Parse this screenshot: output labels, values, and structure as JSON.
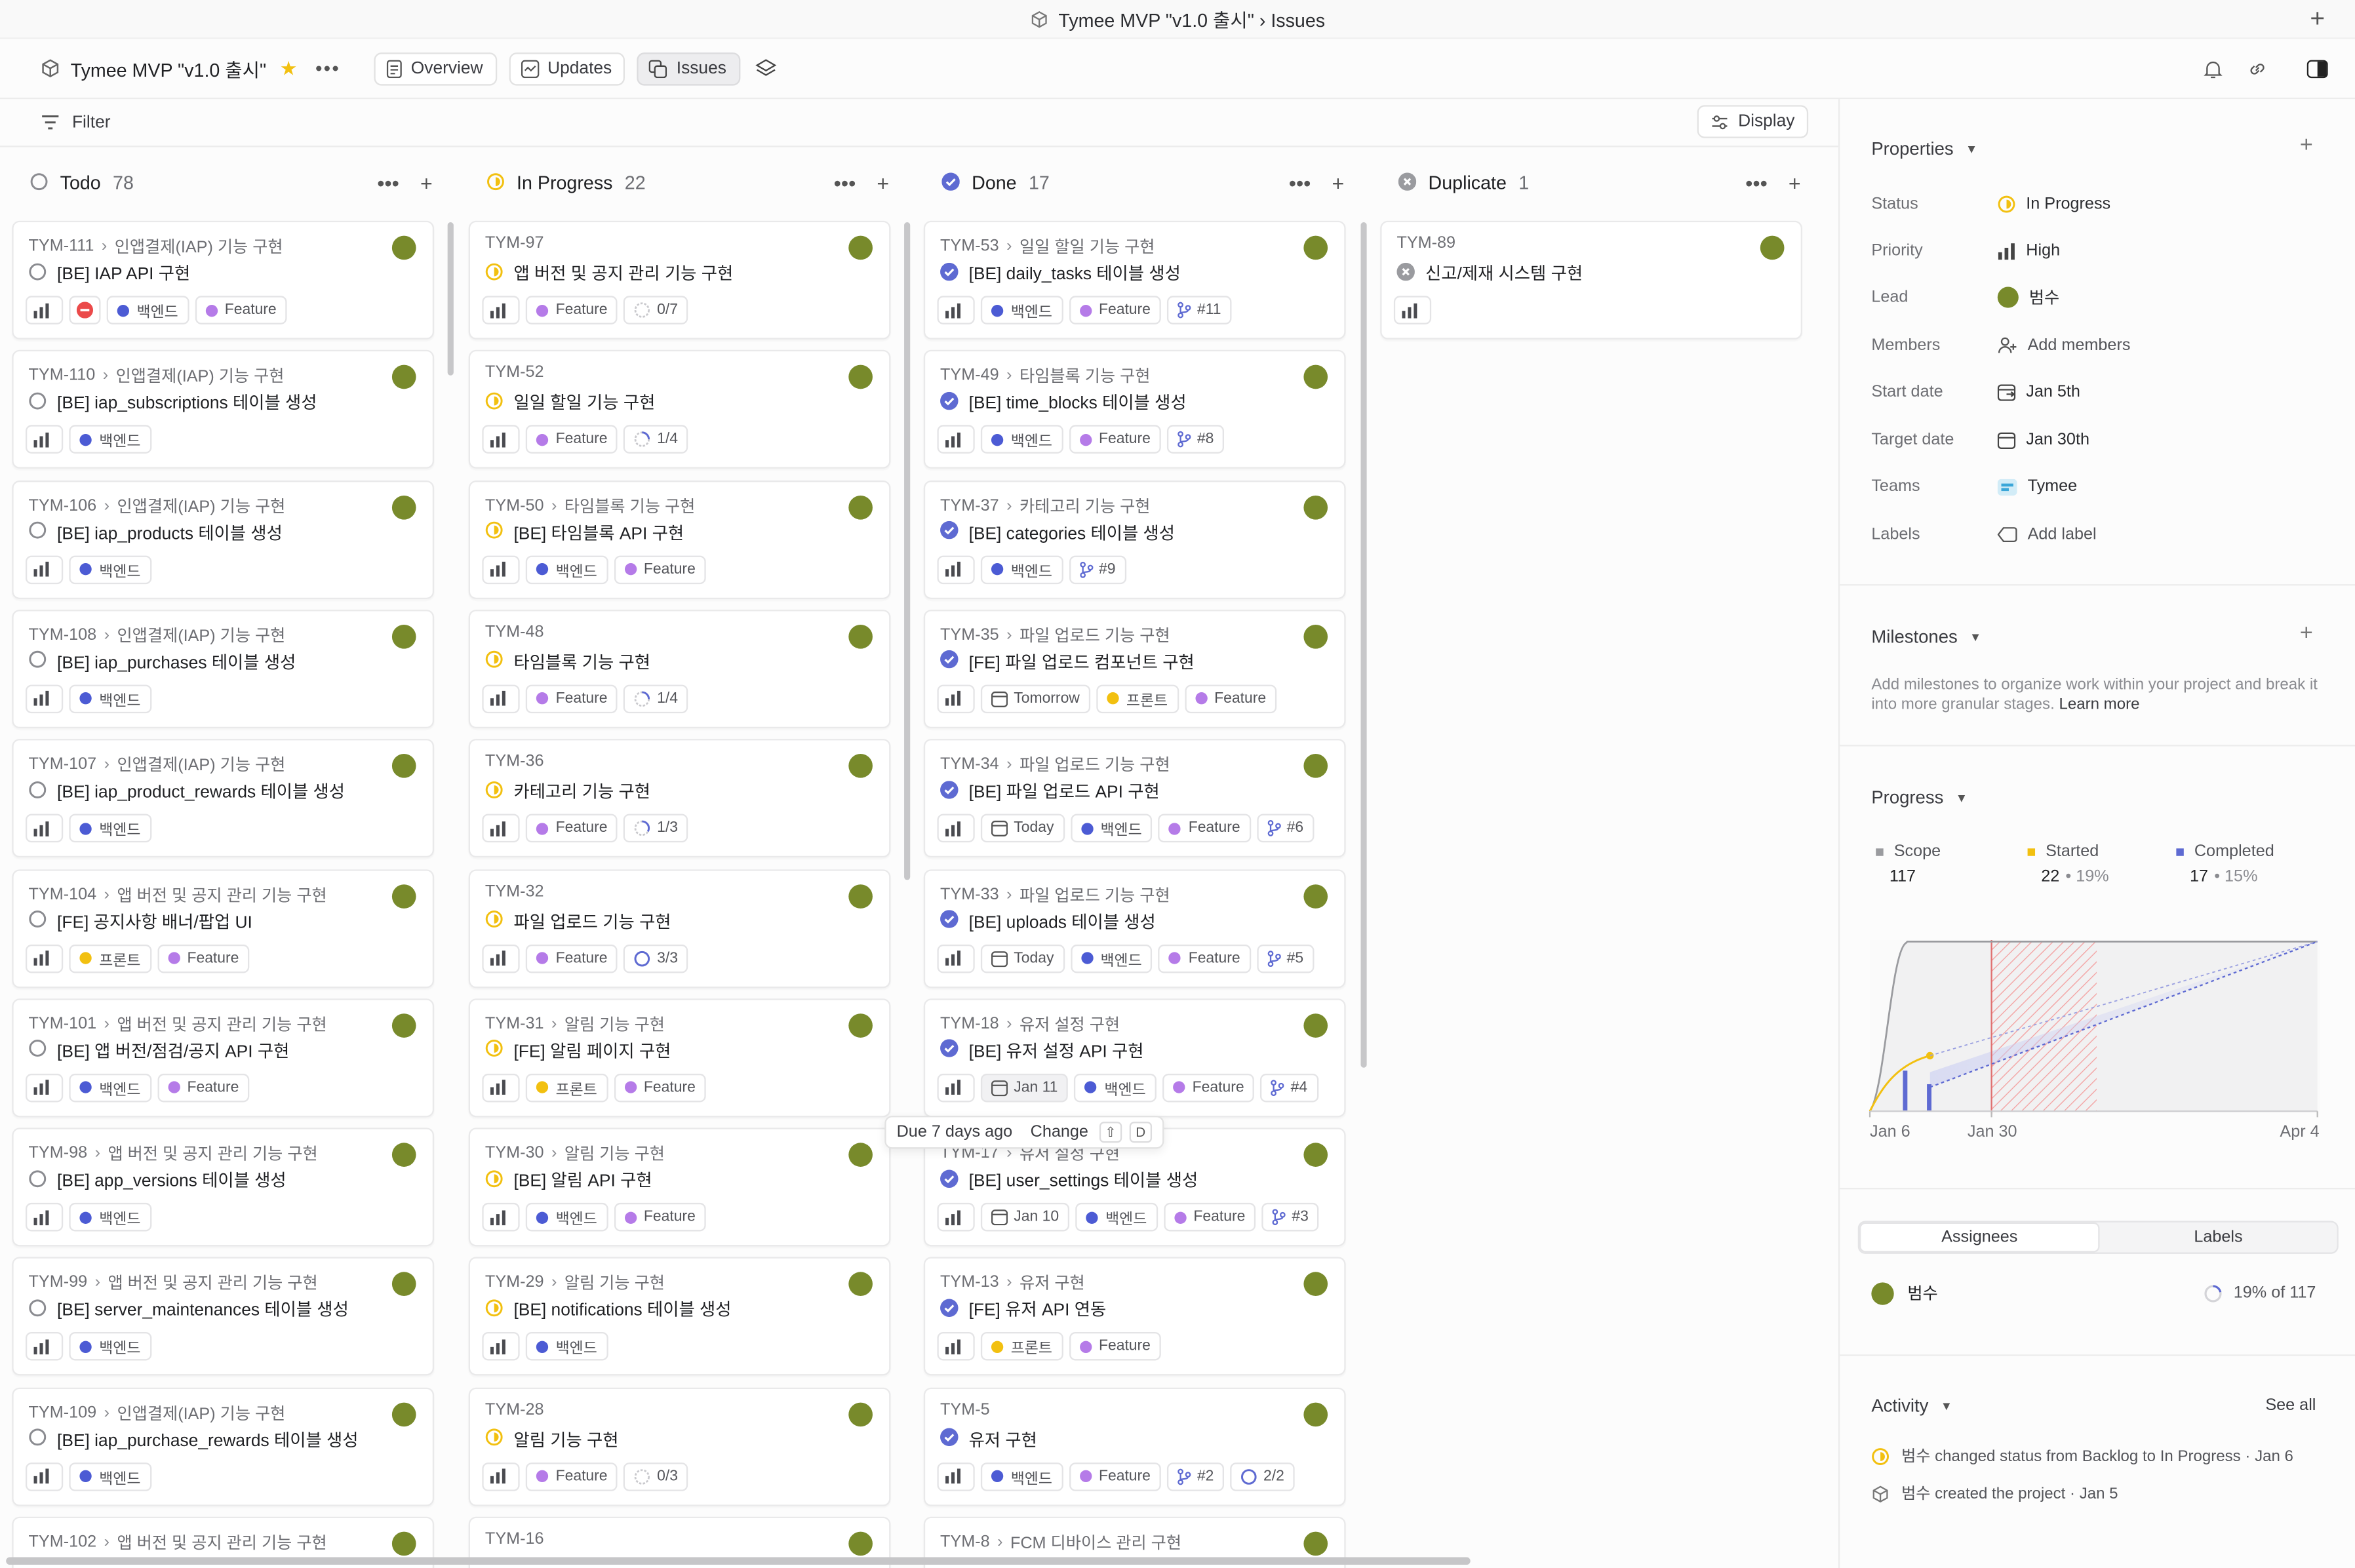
{
  "window": {
    "title": "Tymee MVP \"v1.0 출시\" › Issues"
  },
  "header": {
    "project_name": "Tymee MVP \"v1.0 출시\"",
    "tabs": [
      {
        "label": "Overview"
      },
      {
        "label": "Updates"
      },
      {
        "label": "Issues",
        "active": true
      }
    ]
  },
  "toolbar": {
    "filter_label": "Filter",
    "display_label": "Display"
  },
  "colors": {
    "accent": "#5e6ad2",
    "in_progress": "#f2c010",
    "done": "#5e6ad2",
    "avatar": "#788a2b",
    "backend": "#4c5bd4",
    "feature": "#b57be8",
    "frontend": "#f2c010",
    "urgent": "#eb4a4a"
  },
  "columns": [
    {
      "name": "Todo",
      "count": "78",
      "status": "todo",
      "cards": [
        {
          "id": "TYM-111",
          "parent": "인앱결제(IAP) 기능 구현",
          "title": "[BE] IAP API 구현",
          "chips": [
            {
              "t": "urgent"
            },
            {
              "t": "label",
              "label": "백엔드",
              "color": "#4c5bd4"
            },
            {
              "t": "label",
              "label": "Feature",
              "color": "#b57be8"
            }
          ]
        },
        {
          "id": "TYM-110",
          "parent": "인앱결제(IAP) 기능 구현",
          "title": "[BE] iap_subscriptions 테이블 생성",
          "chips": [
            {
              "t": "label",
              "label": "백엔드",
              "color": "#4c5bd4"
            }
          ]
        },
        {
          "id": "TYM-106",
          "parent": "인앱결제(IAP) 기능 구현",
          "title": "[BE] iap_products 테이블 생성",
          "chips": [
            {
              "t": "label",
              "label": "백엔드",
              "color": "#4c5bd4"
            }
          ]
        },
        {
          "id": "TYM-108",
          "parent": "인앱결제(IAP) 기능 구현",
          "title": "[BE] iap_purchases 테이블 생성",
          "chips": [
            {
              "t": "label",
              "label": "백엔드",
              "color": "#4c5bd4"
            }
          ]
        },
        {
          "id": "TYM-107",
          "parent": "인앱결제(IAP) 기능 구현",
          "title": "[BE] iap_product_rewards 테이블 생성",
          "chips": [
            {
              "t": "label",
              "label": "백엔드",
              "color": "#4c5bd4"
            }
          ]
        },
        {
          "id": "TYM-104",
          "parent": "앱 버전 및 공지 관리 기능 구현",
          "title": "[FE] 공지사항 배너/팝업 UI",
          "chips": [
            {
              "t": "label",
              "label": "프론트",
              "color": "#f2c010"
            },
            {
              "t": "label",
              "label": "Feature",
              "color": "#b57be8"
            }
          ]
        },
        {
          "id": "TYM-101",
          "parent": "앱 버전 및 공지 관리 기능 구현",
          "title": "[BE] 앱 버전/점검/공지 API 구현",
          "chips": [
            {
              "t": "label",
              "label": "백엔드",
              "color": "#4c5bd4"
            },
            {
              "t": "label",
              "label": "Feature",
              "color": "#b57be8"
            }
          ]
        },
        {
          "id": "TYM-98",
          "parent": "앱 버전 및 공지 관리 기능 구현",
          "title": "[BE] app_versions 테이블 생성",
          "chips": [
            {
              "t": "label",
              "label": "백엔드",
              "color": "#4c5bd4"
            }
          ]
        },
        {
          "id": "TYM-99",
          "parent": "앱 버전 및 공지 관리 기능 구현",
          "title": "[BE] server_maintenances 테이블 생성",
          "chips": [
            {
              "t": "label",
              "label": "백엔드",
              "color": "#4c5bd4"
            }
          ]
        },
        {
          "id": "TYM-109",
          "parent": "인앱결제(IAP) 기능 구현",
          "title": "[BE] iap_purchase_rewards 테이블 생성",
          "chips": [
            {
              "t": "label",
              "label": "백엔드",
              "color": "#4c5bd4"
            }
          ]
        },
        {
          "id": "TYM-102",
          "parent": "앱 버전 및 공지 관리 기능 구현",
          "title": "",
          "chips": []
        }
      ]
    },
    {
      "name": "In Progress",
      "count": "22",
      "status": "progress",
      "cards": [
        {
          "id": "TYM-97",
          "parent": "",
          "title": "앱 버전 및 공지 관리 기능 구현",
          "chips": [
            {
              "t": "label",
              "label": "Feature",
              "color": "#b57be8"
            },
            {
              "t": "sub",
              "label": "0/7",
              "frac": 0
            }
          ]
        },
        {
          "id": "TYM-52",
          "parent": "",
          "title": "일일 할일 기능 구현",
          "chips": [
            {
              "t": "label",
              "label": "Feature",
              "color": "#b57be8"
            },
            {
              "t": "sub",
              "label": "1/4",
              "frac": 0.25
            }
          ]
        },
        {
          "id": "TYM-50",
          "parent": "타임블록 기능 구현",
          "title": "[BE] 타임블록 API 구현",
          "chips": [
            {
              "t": "label",
              "label": "백엔드",
              "color": "#4c5bd4"
            },
            {
              "t": "label",
              "label": "Feature",
              "color": "#b57be8"
            }
          ]
        },
        {
          "id": "TYM-48",
          "parent": "",
          "title": "타임블록 기능 구현",
          "chips": [
            {
              "t": "label",
              "label": "Feature",
              "color": "#b57be8"
            },
            {
              "t": "sub",
              "label": "1/4",
              "frac": 0.25
            }
          ]
        },
        {
          "id": "TYM-36",
          "parent": "",
          "title": "카테고리 기능 구현",
          "chips": [
            {
              "t": "label",
              "label": "Feature",
              "color": "#b57be8"
            },
            {
              "t": "sub",
              "label": "1/3",
              "frac": 0.33
            }
          ]
        },
        {
          "id": "TYM-32",
          "parent": "",
          "title": "파일 업로드 기능 구현",
          "chips": [
            {
              "t": "label",
              "label": "Feature",
              "color": "#b57be8"
            },
            {
              "t": "sub",
              "label": "3/3",
              "frac": 1
            }
          ]
        },
        {
          "id": "TYM-31",
          "parent": "알림 기능 구현",
          "title": "[FE] 알림 페이지 구현",
          "chips": [
            {
              "t": "label",
              "label": "프론트",
              "color": "#f2c010"
            },
            {
              "t": "label",
              "label": "Feature",
              "color": "#b57be8"
            }
          ]
        },
        {
          "id": "TYM-30",
          "parent": "알림 기능 구현",
          "title": "[BE] 알림 API 구현",
          "chips": [
            {
              "t": "label",
              "label": "백엔드",
              "color": "#4c5bd4"
            },
            {
              "t": "label",
              "label": "Feature",
              "color": "#b57be8"
            }
          ]
        },
        {
          "id": "TYM-29",
          "parent": "알림 기능 구현",
          "title": "[BE] notifications 테이블 생성",
          "chips": [
            {
              "t": "label",
              "label": "백엔드",
              "color": "#4c5bd4"
            }
          ]
        },
        {
          "id": "TYM-28",
          "parent": "",
          "title": "알림 기능 구현",
          "chips": [
            {
              "t": "label",
              "label": "Feature",
              "color": "#b57be8"
            },
            {
              "t": "sub",
              "label": "0/3",
              "frac": 0
            }
          ]
        },
        {
          "id": "TYM-16",
          "parent": "",
          "title": "",
          "chips": []
        }
      ]
    },
    {
      "name": "Done",
      "count": "17",
      "status": "done",
      "cards": [
        {
          "id": "TYM-53",
          "parent": "일일 할일 기능 구현",
          "title": "[BE] daily_tasks 테이블 생성",
          "chips": [
            {
              "t": "label",
              "label": "백엔드",
              "color": "#4c5bd4"
            },
            {
              "t": "label",
              "label": "Feature",
              "color": "#b57be8"
            },
            {
              "t": "pr",
              "label": "#11"
            }
          ]
        },
        {
          "id": "TYM-49",
          "parent": "타임블록 기능 구현",
          "title": "[BE] time_blocks 테이블 생성",
          "chips": [
            {
              "t": "label",
              "label": "백엔드",
              "color": "#4c5bd4"
            },
            {
              "t": "label",
              "label": "Feature",
              "color": "#b57be8"
            },
            {
              "t": "pr",
              "label": "#8"
            }
          ]
        },
        {
          "id": "TYM-37",
          "parent": "카테고리 기능 구현",
          "title": "[BE] categories 테이블 생성",
          "chips": [
            {
              "t": "label",
              "label": "백엔드",
              "color": "#4c5bd4"
            },
            {
              "t": "pr",
              "label": "#9"
            }
          ]
        },
        {
          "id": "TYM-35",
          "parent": "파일 업로드 기능 구현",
          "title": "[FE] 파일 업로드 컴포넌트 구현",
          "chips": [
            {
              "t": "date",
              "label": "Tomorrow"
            },
            {
              "t": "label",
              "label": "프론트",
              "color": "#f2c010"
            },
            {
              "t": "label",
              "label": "Feature",
              "color": "#b57be8"
            }
          ]
        },
        {
          "id": "TYM-34",
          "parent": "파일 업로드 기능 구현",
          "title": "[BE] 파일 업로드 API 구현",
          "chips": [
            {
              "t": "date",
              "label": "Today"
            },
            {
              "t": "label",
              "label": "백엔드",
              "color": "#4c5bd4"
            },
            {
              "t": "label",
              "label": "Feature",
              "color": "#b57be8"
            },
            {
              "t": "pr",
              "label": "#6"
            }
          ]
        },
        {
          "id": "TYM-33",
          "parent": "파일 업로드 기능 구현",
          "title": "[BE] uploads 테이블 생성",
          "chips": [
            {
              "t": "date",
              "label": "Today"
            },
            {
              "t": "label",
              "label": "백엔드",
              "color": "#4c5bd4"
            },
            {
              "t": "label",
              "label": "Feature",
              "color": "#b57be8"
            },
            {
              "t": "pr",
              "label": "#5"
            }
          ]
        },
        {
          "id": "TYM-18",
          "parent": "유저 설정 구현",
          "title": "[BE] 유저 설정 API 구현",
          "chips": [
            {
              "t": "date",
              "label": "Jan 11",
              "hl": true
            },
            {
              "t": "label",
              "label": "백엔드",
              "color": "#4c5bd4"
            },
            {
              "t": "label",
              "label": "Feature",
              "color": "#b57be8"
            },
            {
              "t": "pr",
              "label": "#4"
            }
          ]
        },
        {
          "id": "TYM-17",
          "parent": "유저 설정 구현",
          "title": "[BE] user_settings 테이블 생성",
          "chips": [
            {
              "t": "date",
              "label": "Jan 10"
            },
            {
              "t": "label",
              "label": "백엔드",
              "color": "#4c5bd4"
            },
            {
              "t": "label",
              "label": "Feature",
              "color": "#b57be8"
            },
            {
              "t": "pr",
              "label": "#3"
            }
          ]
        },
        {
          "id": "TYM-13",
          "parent": "유저 구현",
          "title": "[FE] 유저 API 연동",
          "chips": [
            {
              "t": "label",
              "label": "프론트",
              "color": "#f2c010"
            },
            {
              "t": "label",
              "label": "Feature",
              "color": "#b57be8"
            }
          ]
        },
        {
          "id": "TYM-5",
          "parent": "",
          "title": "유저 구현",
          "chips": [
            {
              "t": "label",
              "label": "백엔드",
              "color": "#4c5bd4"
            },
            {
              "t": "label",
              "label": "Feature",
              "color": "#b57be8"
            },
            {
              "t": "pr",
              "label": "#2"
            },
            {
              "t": "sub",
              "label": "2/2",
              "frac": 1
            }
          ]
        },
        {
          "id": "TYM-8",
          "parent": "FCM 디바이스 관리 구현",
          "title": "",
          "chips": []
        }
      ]
    },
    {
      "name": "Duplicate",
      "count": "1",
      "status": "duplicate",
      "cards": [
        {
          "id": "TYM-89",
          "parent": "",
          "title": "신고/제재 시스템 구현",
          "chips": []
        }
      ]
    }
  ],
  "tooltip": {
    "text": "Due 7 days ago",
    "action": "Change",
    "shortcut": "D",
    "shortcut_mod": "⇧"
  },
  "sidebar": {
    "properties": {
      "title": "Properties",
      "rows": [
        {
          "label": "Status",
          "value": "In Progress"
        },
        {
          "label": "Priority",
          "value": "High"
        },
        {
          "label": "Lead",
          "value": "범수"
        },
        {
          "label": "Members",
          "value": "Add members"
        },
        {
          "label": "Start date",
          "value": "Jan 5th"
        },
        {
          "label": "Target date",
          "value": "Jan 30th"
        },
        {
          "label": "Teams",
          "value": "Tymee"
        },
        {
          "label": "Labels",
          "value": "Add label"
        }
      ]
    },
    "milestones": {
      "title": "Milestones",
      "text": "Add milestones to organize work within your project and break it into more granular stages.",
      "link": "Learn more"
    },
    "progress": {
      "title": "Progress",
      "scope": {
        "label": "Scope",
        "value": "117"
      },
      "started": {
        "label": "Started",
        "value": "22",
        "pct": "• 19%"
      },
      "completed": {
        "label": "Completed",
        "value": "17",
        "pct": "• 15%"
      },
      "x_ticks": [
        "Jan 6",
        "Jan 30",
        "Apr 4"
      ]
    },
    "assignees": {
      "tab_assignees": "Assignees",
      "tab_labels": "Labels",
      "name": "범수",
      "progress": "19% of 117",
      "frac": 0.19
    },
    "activity": {
      "title": "Activity",
      "see_all": "See all",
      "items": [
        "범수 changed status from Backlog to In Progress · Jan 6",
        "범수 created the project · Jan 5"
      ]
    }
  }
}
